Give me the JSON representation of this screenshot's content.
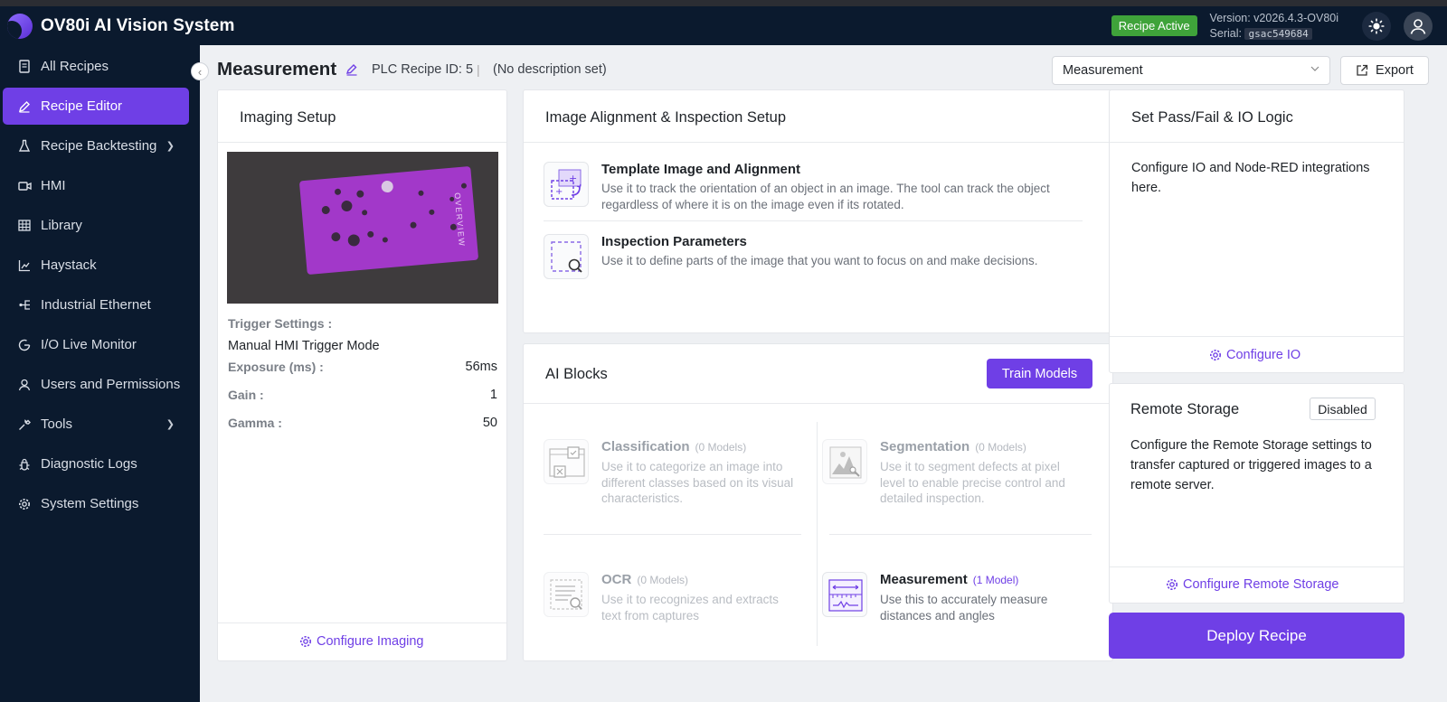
{
  "app": {
    "title": "OV80i AI Vision System",
    "status_badge": "Recipe Active",
    "version": "Version: v2026.4.3-OV80i",
    "serial_label": "Serial:",
    "serial": "gsac549684",
    "theme_icon": "sun-icon",
    "user_icon": "user-icon"
  },
  "sidebar": {
    "items": [
      {
        "label": "All Recipes",
        "icon": "book-icon"
      },
      {
        "label": "Recipe Editor",
        "icon": "pencil-icon",
        "active": true
      },
      {
        "label": "Recipe Backtesting",
        "icon": "flask-icon",
        "expandable": true
      },
      {
        "label": "HMI",
        "icon": "camera-icon"
      },
      {
        "label": "Library",
        "icon": "table-icon"
      },
      {
        "label": "Haystack",
        "icon": "chart-icon"
      },
      {
        "label": "Industrial Ethernet",
        "icon": "network-icon"
      },
      {
        "label": "I/O Live Monitor",
        "icon": "gauge-icon"
      },
      {
        "label": "Users and Permissions",
        "icon": "person-icon"
      },
      {
        "label": "Tools",
        "icon": "wrench-icon",
        "expandable": true
      },
      {
        "label": "Diagnostic Logs",
        "icon": "bug-icon"
      },
      {
        "label": "System Settings",
        "icon": "gear-icon"
      }
    ]
  },
  "header": {
    "title": "Measurement",
    "plc": "PLC Recipe ID: 5",
    "separator": "|",
    "description": "(No description set)",
    "selected_recipe": "Measurement",
    "export_label": "Export"
  },
  "imaging": {
    "title": "Imaging Setup",
    "preview_text": "OVERVIEW",
    "trigger_label": "Trigger Settings :",
    "trigger_mode": "Manual HMI Trigger Mode",
    "exposure_label": "Exposure (ms) :",
    "exposure_value": "56ms",
    "gain_label": "Gain :",
    "gain_value": "1",
    "gamma_label": "Gamma :",
    "gamma_value": "50",
    "configure_label": "Configure Imaging"
  },
  "alignment": {
    "title": "Image Alignment & Inspection Setup",
    "tools": [
      {
        "title": "Template Image and Alignment",
        "desc": "Use it to track the orientation of an object in an image. The tool can track the object regardless of where it is on the image even if its rotated."
      },
      {
        "title": "Inspection Parameters",
        "desc": "Use it to define parts of the image that you want to focus on and make decisions."
      }
    ]
  },
  "ai_blocks": {
    "title": "AI Blocks",
    "train_label": "Train Models",
    "blocks": [
      {
        "title": "Classification",
        "count": "(0 Models)",
        "desc": "Use it to categorize an image into different classes based on its visual characteristics."
      },
      {
        "title": "Segmentation",
        "count": "(0 Models)",
        "desc": "Use it to segment defects at pixel level to enable precise control and detailed inspection."
      },
      {
        "title": "OCR",
        "count": "(0 Models)",
        "desc": "Use it to recognizes and extracts text from captures"
      },
      {
        "title": "Measurement",
        "count": "(1 Model)",
        "desc": "Use this to accurately measure distances and angles"
      }
    ]
  },
  "passfail": {
    "title": "Set Pass/Fail & IO Logic",
    "desc": "Configure IO and Node-RED integrations here.",
    "configure_label": "Configure IO"
  },
  "remote": {
    "title": "Remote Storage",
    "status": "Disabled",
    "desc": "Configure the Remote Storage settings to transfer captured or triggered images to a remote server.",
    "configure_label": "Configure Remote Storage"
  },
  "deploy_label": "Deploy Recipe",
  "colors": {
    "accent": "#6f3fe6",
    "sidebar_bg": "#0b1a2e",
    "badge_green": "#3fa33a"
  }
}
